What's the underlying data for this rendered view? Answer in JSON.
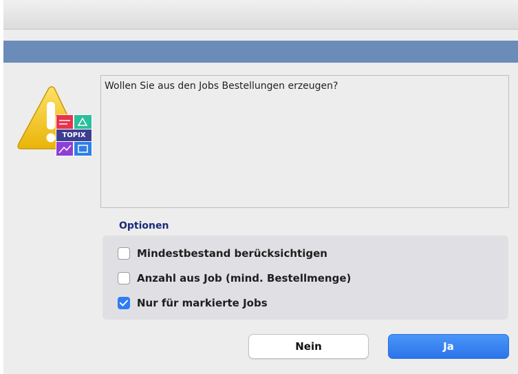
{
  "dialog": {
    "message": "Wollen Sie aus den Jobs Bestellungen erzeugen?",
    "icon": "warning-topix-icon",
    "icon_label": "TOPIX"
  },
  "options": {
    "title": "Optionen",
    "items": [
      {
        "label": "Mindestbestand berücksichtigen",
        "checked": false
      },
      {
        "label": "Anzahl aus Job (mind. Bestellmenge)",
        "checked": false
      },
      {
        "label": "Nur für markierte Jobs",
        "checked": true
      }
    ]
  },
  "buttons": {
    "no_label": "Nein",
    "yes_label": "Ja"
  },
  "colors": {
    "header_band": "#6b8cb9",
    "accent": "#2f7cf6",
    "options_title": "#1c2a7a"
  }
}
